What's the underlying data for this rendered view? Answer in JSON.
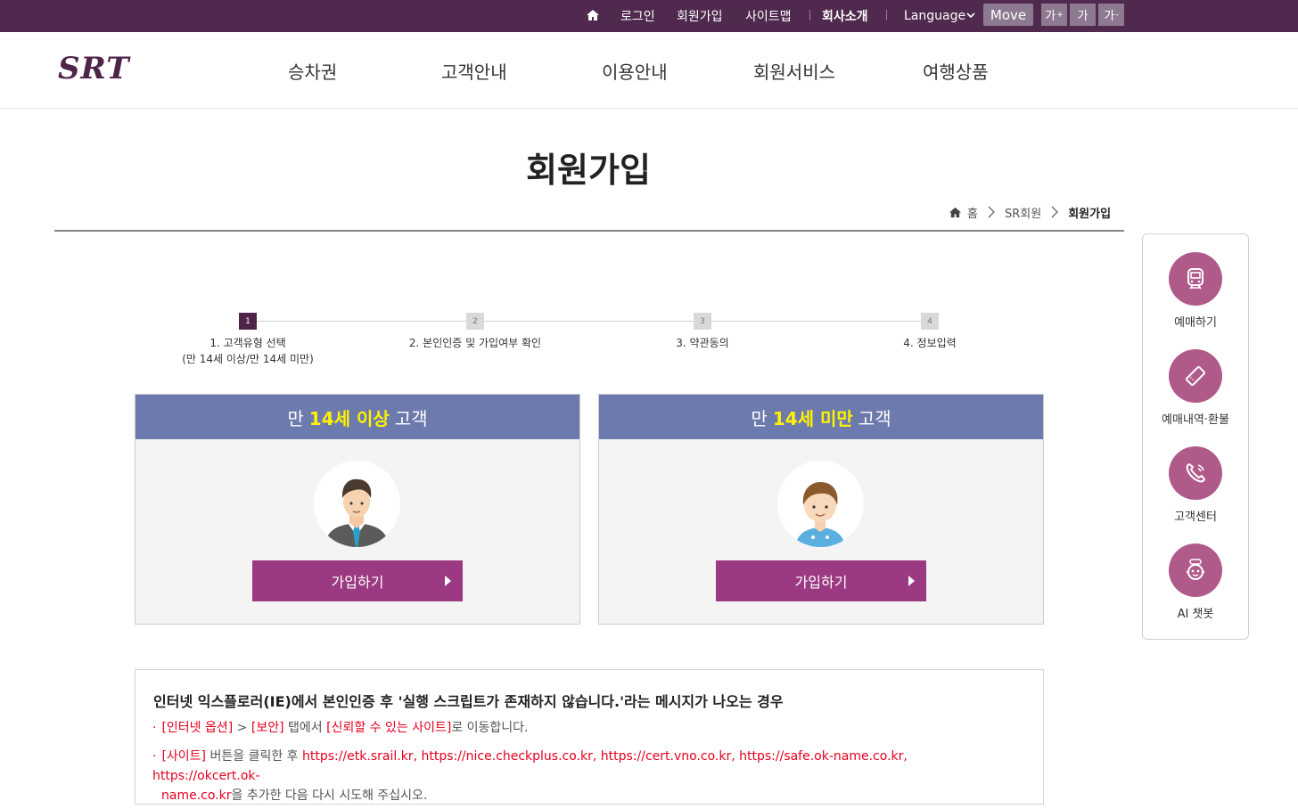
{
  "topbar": {
    "login": "로그인",
    "join": "회원가입",
    "sitemap": "사이트맵",
    "company": "회사소개",
    "language": "Language",
    "move": "Move",
    "font_up": "가",
    "font_up_sup": "+",
    "font_normal": "가",
    "font_down": "가",
    "font_down_sup": "-"
  },
  "nav": {
    "logo": "SRT",
    "items": [
      "승차권",
      "고객안내",
      "이용안내",
      "회원서비스",
      "여행상품"
    ]
  },
  "page": {
    "title": "회원가입",
    "breadcrumb": [
      "홈",
      "SR회원",
      "회원가입"
    ]
  },
  "steps": [
    {
      "num": "1",
      "label": "1. 고객유형 선택",
      "sub": "(만 14세 이상/만 14세 미만)",
      "active": true
    },
    {
      "num": "2",
      "label": "2. 본인인증 및 가입여부 확인",
      "sub": "",
      "active": false
    },
    {
      "num": "3",
      "label": "3. 약관동의",
      "sub": "",
      "active": false
    },
    {
      "num": "4",
      "label": "4. 정보입력",
      "sub": "",
      "active": false
    }
  ],
  "cards": [
    {
      "pre": "만",
      "highlight": "14세 이상",
      "post": "고객",
      "button": "가입하기"
    },
    {
      "pre": "만",
      "highlight": "14세 미만",
      "post": "고객",
      "button": "가입하기"
    }
  ],
  "notice": {
    "title": "인터넷 익스플로러(IE)에서 본인인증 후 '실행 스크립트가 존재하지 않습니다.'라는 메시지가 나오는 경우",
    "item1": {
      "a": "[인터넷 옵션]",
      "sep": " > ",
      "b": "[보안]",
      "mid": " 탭에서 ",
      "c": "[신뢰할 수 있는 사이트]",
      "end": "로 이동합니다."
    },
    "item2": {
      "a": "[사이트]",
      "mid": " 버튼을 클릭한 후 ",
      "urls": "https://etk.srail.kr, https://nice.checkplus.co.kr, https://cert.vno.co.kr, https://safe.ok-name.co.kr, https://okcert.ok-",
      "urls2": "name.co.kr",
      "end": "을 추가한 다음 다시 시도해 주십시오."
    }
  },
  "quick_menu": [
    {
      "label": "예매하기",
      "icon": "train-icon"
    },
    {
      "label": "예매내역·환불",
      "icon": "ticket-icon"
    },
    {
      "label": "고객센터",
      "icon": "phone-icon"
    },
    {
      "label": "AI 챗봇",
      "icon": "chatbot-icon"
    }
  ],
  "colors": {
    "topbar": "#502a4e",
    "card_header": "#6c7aae",
    "highlight": "#fff200",
    "join_button": "#9b3a82",
    "quick_circle": "#b05a89",
    "notice_red": "#e6001f"
  }
}
